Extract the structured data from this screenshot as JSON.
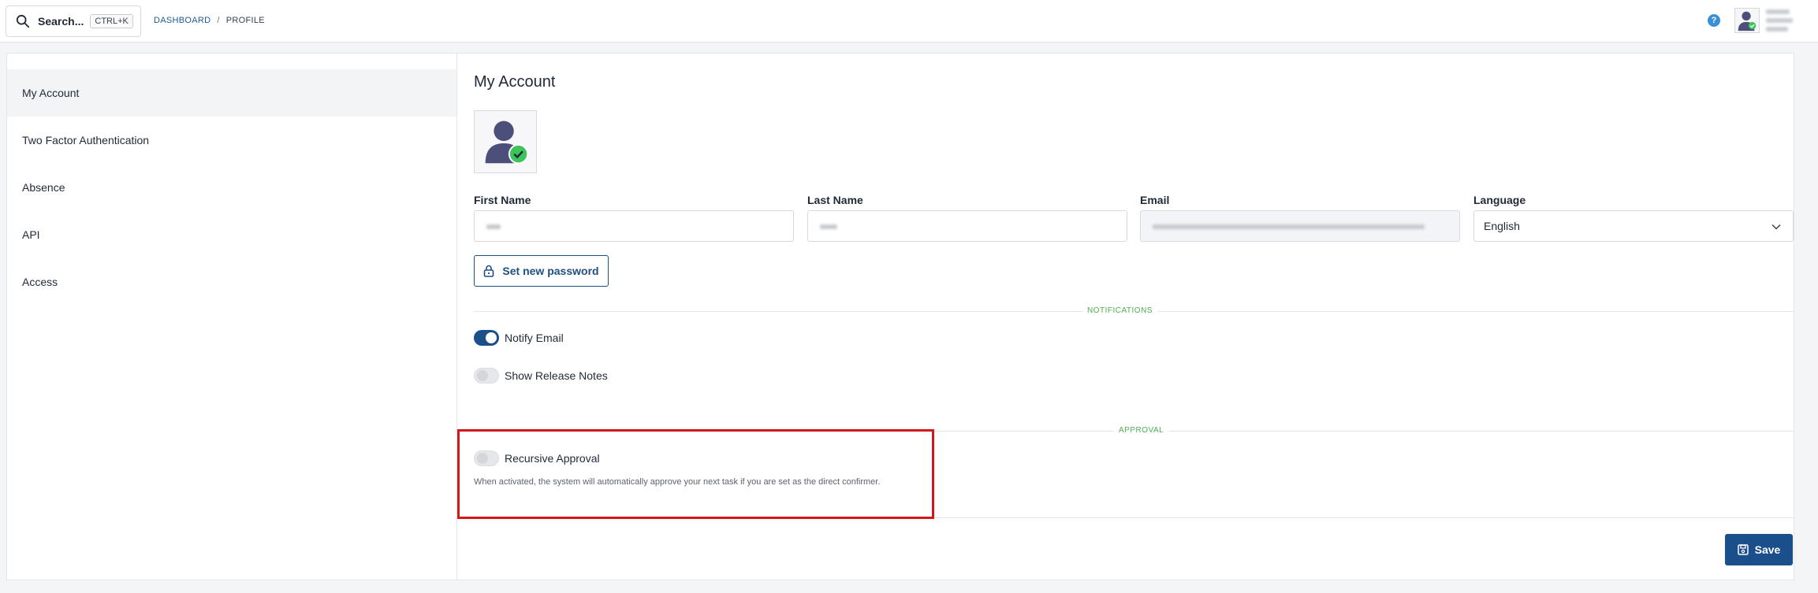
{
  "header": {
    "search_label": "Search...",
    "search_shortcut": "CTRL+K",
    "breadcrumb": {
      "root": "DASHBOARD",
      "separator": "/",
      "current": "PROFILE"
    },
    "help_icon_glyph": "?"
  },
  "sidebar": {
    "items": [
      {
        "label": "My Account",
        "active": true
      },
      {
        "label": "Two Factor Authentication",
        "active": false
      },
      {
        "label": "Absence",
        "active": false
      },
      {
        "label": "API",
        "active": false
      },
      {
        "label": "Access",
        "active": false
      }
    ]
  },
  "account": {
    "title": "My Account",
    "fields": {
      "first_name_label": "First Name",
      "last_name_label": "Last Name",
      "email_label": "Email",
      "language_label": "Language",
      "language_value": "English"
    },
    "set_password_label": "Set new password",
    "notifications_section": "NOTIFICATIONS",
    "notify_email_label": "Notify Email",
    "notify_email_on": true,
    "release_notes_label": "Show Release Notes",
    "release_notes_on": false,
    "approval_section": "APPROVAL",
    "recursive_approval_label": "Recursive Approval",
    "recursive_approval_on": false,
    "recursive_approval_help": "When activated, the system will automatically approve your next task if you are set as the direct confirmer.",
    "save_label": "Save"
  },
  "colors": {
    "primary": "#1a4f8b",
    "section_label": "#4caf50",
    "highlight": "#d0181d",
    "avatar_check": "#3cc45b",
    "avatar_person": "#4b4f7a"
  }
}
